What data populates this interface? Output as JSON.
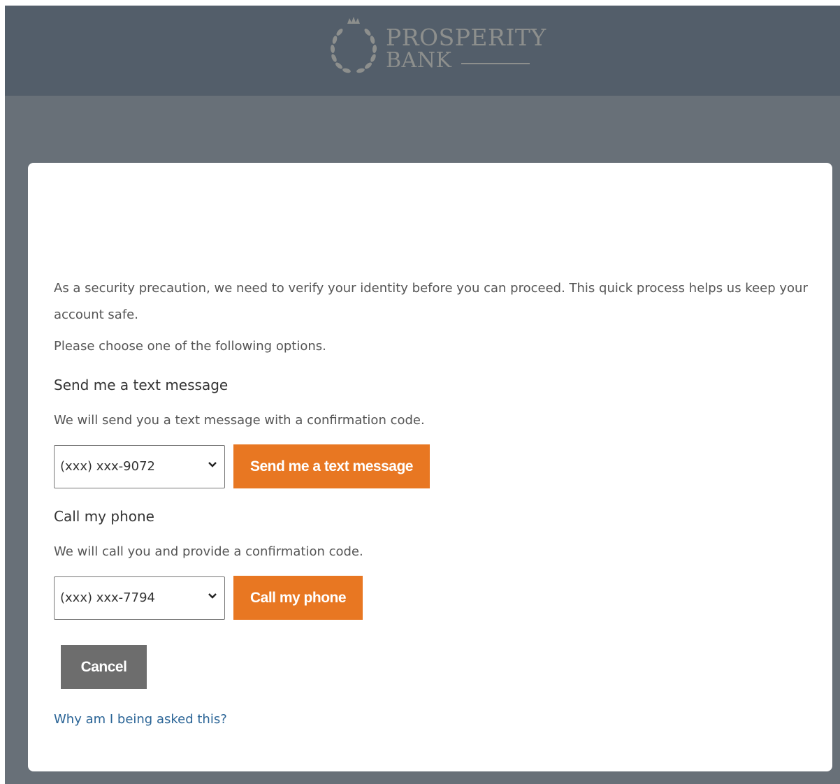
{
  "header": {
    "logo": {
      "name_line1": "PROSPERITY",
      "name_line2": "BANK",
      "icon": "laurel-wreath-crown-icon",
      "color": "#8d8f8d"
    },
    "background_color": "#535e6a"
  },
  "page": {
    "background_color": "#687078"
  },
  "verify": {
    "intro": "As a security precaution, we need to verify your identity before you can proceed. This quick process helps us keep your account safe.",
    "choose": "Please choose one of the following options.",
    "text_option": {
      "title": "Send me a text message",
      "description": "We will send you a text message with a confirmation code.",
      "selected_phone": "(xxx) xxx-9072",
      "button_label": "Send me a text message"
    },
    "call_option": {
      "title": "Call my phone",
      "description": "We will call you and provide a confirmation code.",
      "selected_phone": "(xxx) xxx-7794",
      "button_label": "Call my phone"
    },
    "cancel_label": "Cancel",
    "help_link": "Why am I being asked this?"
  },
  "colors": {
    "accent_orange": "#e87722",
    "cancel_gray": "#6d6d6d",
    "link_blue": "#2a6496"
  }
}
